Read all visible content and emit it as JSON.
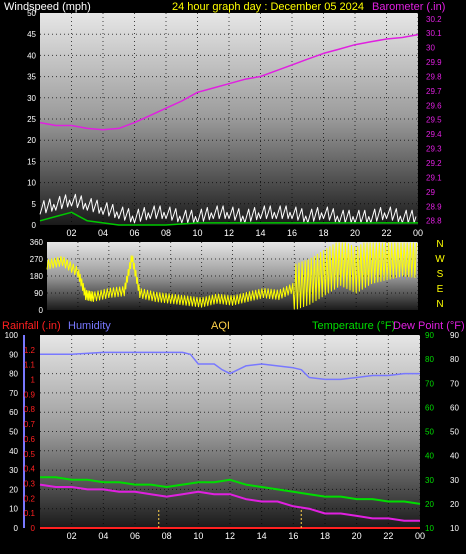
{
  "header": {
    "wind_label": "Windspeed (mph)",
    "date_label": "24 hour graph day : December 05 2024",
    "baro_label": "Barometer (.in)"
  },
  "bottom_header": {
    "rain_label": "Rainfall (.in)",
    "humidity_label": "Humidity",
    "aqi_label": "AQI",
    "temp_label": "Temperature (°F)",
    "dew_label": "Dew Point (°F)"
  },
  "colors": {
    "wind": "#ffffff",
    "wind_gust": "#00c800",
    "baro": "#e020e0",
    "direction": "#ffff00",
    "humidity": "#7878ff",
    "temperature": "#00dd00",
    "dewpoint": "#e020e0",
    "rain": "#ff2020",
    "aqi": "#ffd24a",
    "date": "#ffff00",
    "grid": "#000000"
  },
  "chart_data": [
    {
      "type": "line",
      "title": "24 hour graph day : December 05 2024",
      "xticks": [
        "02",
        "04",
        "06",
        "08",
        "10",
        "12",
        "14",
        "16",
        "18",
        "20",
        "22",
        "00"
      ],
      "xlim": [
        0,
        24
      ],
      "yleft_label": "Windspeed (mph)",
      "yleft_ticks": [
        "0",
        "5",
        "10",
        "15",
        "20",
        "25",
        "30",
        "35",
        "40",
        "45",
        "50"
      ],
      "yleft_lim": [
        0,
        50
      ],
      "yright_label": "Barometer (.in)",
      "yright_ticks": [
        "28.8",
        "28.9",
        "29",
        "29.1",
        "29.2",
        "29.3",
        "29.4",
        "29.5",
        "29.6",
        "29.7",
        "29.8",
        "29.9",
        "30",
        "30.1",
        "30.2"
      ],
      "yright_lim": [
        28.77,
        30.24
      ],
      "grid": true,
      "series": [
        {
          "name": "Barometer",
          "axis": "right",
          "x": [
            0,
            1,
            2,
            3,
            4,
            5,
            6,
            7,
            8,
            9,
            10,
            11,
            12,
            13,
            14,
            15,
            16,
            17,
            18,
            19,
            20,
            21,
            22,
            23,
            24
          ],
          "y": [
            29.48,
            29.46,
            29.46,
            29.44,
            29.43,
            29.44,
            29.48,
            29.53,
            29.58,
            29.63,
            29.69,
            29.72,
            29.75,
            29.78,
            29.8,
            29.84,
            29.88,
            29.92,
            29.96,
            29.99,
            30.02,
            30.04,
            30.06,
            30.07,
            30.09
          ]
        },
        {
          "name": "Windspeed",
          "axis": "left",
          "x": [
            0,
            1,
            2,
            3,
            4,
            5,
            6,
            7,
            8,
            9,
            10,
            11,
            12,
            13,
            14,
            15,
            16,
            17,
            18,
            19,
            20,
            21,
            22,
            23,
            24
          ],
          "y": [
            4,
            5,
            6,
            5,
            4,
            3,
            2,
            3,
            3,
            2,
            2,
            3,
            3,
            2,
            3,
            3,
            3,
            2,
            3,
            2,
            2,
            2,
            3,
            2,
            2
          ]
        },
        {
          "name": "Gust",
          "axis": "left",
          "x": [
            0,
            1,
            2,
            3,
            4,
            5,
            6,
            8,
            10,
            12,
            14,
            16,
            18,
            20,
            22,
            24
          ],
          "y": [
            1,
            2,
            3,
            1,
            0.5,
            0,
            0,
            0,
            0.5,
            0.5,
            0.5,
            0.5,
            0.5,
            0.5,
            0.5,
            0.5
          ]
        }
      ]
    },
    {
      "type": "line",
      "xlim": [
        0,
        24
      ],
      "yleft_ticks": [
        "0",
        "90",
        "180",
        "270",
        "360"
      ],
      "yleft_lim": [
        0,
        360
      ],
      "yright_ticks": [
        "N",
        "W",
        "S",
        "E",
        "N"
      ],
      "series": [
        {
          "name": "Wind Direction",
          "x": [
            0,
            1,
            2,
            2.5,
            3,
            4,
            5,
            5.5,
            6,
            7,
            8,
            9,
            10,
            11,
            12,
            13,
            14,
            15,
            16,
            17,
            18,
            19,
            20,
            21,
            22,
            23,
            24
          ],
          "y": [
            240,
            260,
            200,
            80,
            70,
            90,
            100,
            280,
            90,
            70,
            60,
            50,
            40,
            60,
            50,
            70,
            90,
            80,
            120,
            150,
            200,
            250,
            210,
            260,
            280,
            300,
            290
          ]
        }
      ]
    },
    {
      "type": "line",
      "xlim": [
        0,
        24
      ],
      "y_humidity_ticks": [
        "0",
        "10",
        "20",
        "30",
        "40",
        "50",
        "60",
        "70",
        "80",
        "90",
        "100"
      ],
      "y_humidity_lim": [
        0,
        100
      ],
      "y_rain_ticks": [
        "0",
        "0.1",
        "0.2",
        "0.3",
        "0.4",
        "0.5",
        "0.6",
        "0.7",
        "0.8",
        "0.9",
        "1",
        "1.1",
        "1.2"
      ],
      "y_rain_lim": [
        0,
        1.3
      ],
      "y_temp_ticks": [
        "10",
        "20",
        "30",
        "40",
        "50",
        "60",
        "70",
        "80",
        "90"
      ],
      "y_temp_lim": [
        10,
        90
      ],
      "y_dew_ticks": [
        "10",
        "20",
        "30",
        "40",
        "50",
        "60",
        "70",
        "80",
        "90"
      ],
      "grid": true,
      "series": [
        {
          "name": "Humidity",
          "axis": "humidity",
          "x": [
            0,
            2,
            4,
            6,
            8,
            9,
            9.5,
            10,
            11,
            11.5,
            12,
            13,
            14,
            15,
            16,
            16.5,
            17,
            18,
            19,
            20,
            21,
            22,
            23,
            24
          ],
          "y": [
            90,
            90,
            91,
            91,
            91,
            91,
            90,
            85,
            85,
            82,
            80,
            84,
            85,
            84,
            83,
            82,
            78,
            77,
            77,
            78,
            79,
            79,
            80,
            80
          ]
        },
        {
          "name": "Temperature (°F)",
          "axis": "temp",
          "x": [
            0,
            1,
            2,
            3,
            4,
            5,
            6,
            7,
            8,
            9,
            10,
            11,
            12,
            13,
            14,
            15,
            16,
            17,
            18,
            19,
            20,
            21,
            22,
            23,
            24
          ],
          "y": [
            31,
            31,
            30,
            30,
            29,
            29,
            28,
            28,
            27,
            28,
            29,
            29,
            30,
            28,
            27,
            26,
            25,
            24,
            23,
            23,
            22,
            22,
            21,
            21,
            20
          ]
        },
        {
          "name": "Dew Point (°F)",
          "axis": "temp",
          "x": [
            0,
            1,
            2,
            3,
            4,
            5,
            6,
            7,
            8,
            9,
            10,
            11,
            12,
            13,
            14,
            15,
            16,
            17,
            18,
            19,
            20,
            21,
            22,
            23,
            24
          ],
          "y": [
            28,
            27,
            27,
            26,
            26,
            25,
            25,
            24,
            23,
            24,
            25,
            24,
            24,
            22,
            21,
            21,
            19,
            18,
            16,
            16,
            15,
            14,
            14,
            13,
            13
          ]
        },
        {
          "name": "Rainfall (.in)",
          "axis": "rain",
          "x": [
            0,
            24
          ],
          "y": [
            0,
            0
          ]
        },
        {
          "name": "AQI",
          "axis": "marker",
          "x": [
            7.5,
            16.5
          ]
        }
      ]
    }
  ]
}
